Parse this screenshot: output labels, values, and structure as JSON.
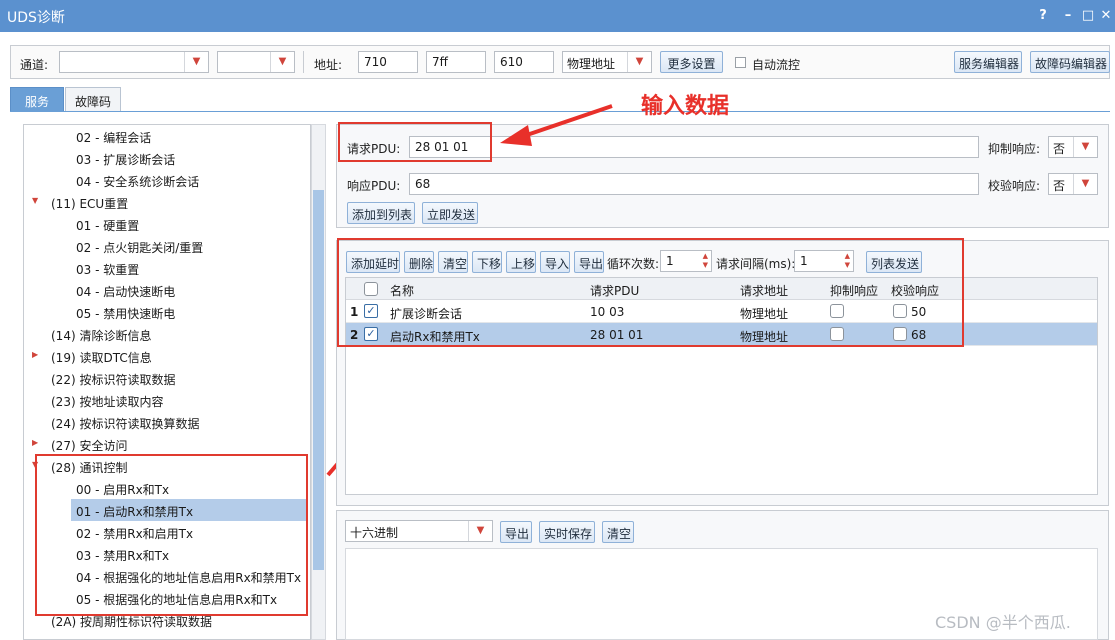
{
  "window": {
    "title": "UDS诊断",
    "controls": [
      "?",
      "–",
      "□",
      "✕"
    ]
  },
  "toolbar": {
    "channel_label": "通道:",
    "channel_value": "",
    "channel2_value": "",
    "address_label": "地址:",
    "addr1": "710",
    "addr2": "7ff",
    "addr3": "610",
    "addr_mode": "物理地址",
    "more_settings": "更多设置",
    "auto_flow_label": "自动流控",
    "service_editor": "服务编辑器",
    "dtc_editor": "故障码编辑器"
  },
  "tabs": [
    "服务",
    "故障码"
  ],
  "tree": {
    "items": [
      {
        "label": "02 - 编程会话",
        "level": 2
      },
      {
        "label": "03 - 扩展诊断会话",
        "level": 2
      },
      {
        "label": "04 - 安全系统诊断会话",
        "level": 2
      },
      {
        "label": "(11) ECU重置",
        "level": 1,
        "expanded": true
      },
      {
        "label": "01 - 硬重置",
        "level": 2
      },
      {
        "label": "02 - 点火钥匙关闭/重置",
        "level": 2
      },
      {
        "label": "03 - 软重置",
        "level": 2
      },
      {
        "label": "04 - 启动快速断电",
        "level": 2
      },
      {
        "label": "05 - 禁用快速断电",
        "level": 2
      },
      {
        "label": "(14) 清除诊断信息",
        "level": 1
      },
      {
        "label": "(19) 读取DTC信息",
        "level": 1,
        "collapsed": true
      },
      {
        "label": "(22) 按标识符读取数据",
        "level": 1
      },
      {
        "label": "(23) 按地址读取内容",
        "level": 1
      },
      {
        "label": "(24) 按标识符读取换算数据",
        "level": 1
      },
      {
        "label": "(27) 安全访问",
        "level": 1,
        "collapsed": true
      },
      {
        "label": "(28) 通讯控制",
        "level": 1,
        "expanded": true
      },
      {
        "label": "00 - 启用Rx和Tx",
        "level": 2
      },
      {
        "label": "01 - 启动Rx和禁用Tx",
        "level": 2,
        "selected": true
      },
      {
        "label": "02 - 禁用Rx和启用Tx",
        "level": 2
      },
      {
        "label": "03 - 禁用Rx和Tx",
        "level": 2
      },
      {
        "label": "04 - 根据强化的地址信息启用Rx和禁用Tx",
        "level": 2
      },
      {
        "label": "05 - 根据强化的地址信息启用Rx和Tx",
        "level": 2
      },
      {
        "label": "(2A) 按周期性标识符读取数据",
        "level": 1
      }
    ]
  },
  "request": {
    "req_label": "请求PDU:",
    "req_value": "28 01 01",
    "resp_label": "响应PDU:",
    "resp_value": "68",
    "suppress_label": "抑制响应:",
    "suppress_value": "否",
    "verify_label": "校验响应:",
    "verify_value": "否",
    "add_to_list": "添加到列表",
    "send_now": "立即发送"
  },
  "list_toolbar": {
    "add_delay": "添加延时",
    "delete": "删除",
    "clear": "清空",
    "move_down": "下移",
    "move_up": "上移",
    "import": "导入",
    "export": "导出",
    "loop_label": "循环次数:",
    "loop_value": "1",
    "interval_label": "请求间隔(ms):",
    "interval_value": "1",
    "list_send": "列表发送"
  },
  "table": {
    "headers": [
      "名称",
      "请求PDU",
      "请求地址",
      "抑制响应",
      "校验响应"
    ],
    "rows": [
      {
        "num": "1",
        "checked": true,
        "name": "扩展诊断会话",
        "pdu": "10 03",
        "addr": "物理地址",
        "suppress": false,
        "verify": "50"
      },
      {
        "num": "2",
        "checked": true,
        "name": "启动Rx和禁用Tx",
        "pdu": "28 01 01",
        "addr": "物理地址",
        "suppress": false,
        "verify": "68"
      }
    ]
  },
  "output": {
    "format": "十六进制",
    "export": "导出",
    "realtime_save": "实时保存",
    "clear": "清空"
  },
  "annotation": {
    "text": "输入数据"
  },
  "watermark": "CSDN @半个西瓜."
}
